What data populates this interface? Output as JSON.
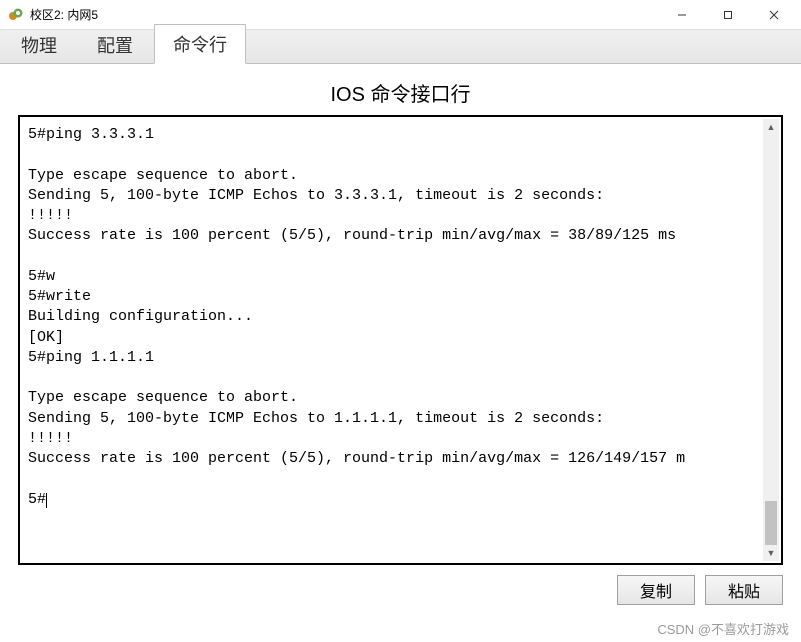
{
  "window": {
    "title": "校区2: 内网5",
    "controls": {
      "minimize": "—",
      "maximize": "☐",
      "close": "✕"
    }
  },
  "tabs": [
    {
      "label": "物理",
      "active": false
    },
    {
      "label": "配置",
      "active": false
    },
    {
      "label": "命令行",
      "active": true
    }
  ],
  "cli": {
    "heading": "IOS 命令接口行",
    "output": "5#ping 3.3.3.1\n\nType escape sequence to abort.\nSending 5, 100-byte ICMP Echos to 3.3.3.1, timeout is 2 seconds:\n!!!!!\nSuccess rate is 100 percent (5/5), round-trip min/avg/max = 38/89/125 ms\n\n5#w\n5#write\nBuilding configuration...\n[OK]\n5#ping 1.1.1.1\n\nType escape sequence to abort.\nSending 5, 100-byte ICMP Echos to 1.1.1.1, timeout is 2 seconds:\n!!!!!\nSuccess rate is 100 percent (5/5), round-trip min/avg/max = 126/149/157 m\n\n5#"
  },
  "buttons": {
    "copy": "复制",
    "paste": "粘贴"
  },
  "watermark": "CSDN @不喜欢打游戏"
}
